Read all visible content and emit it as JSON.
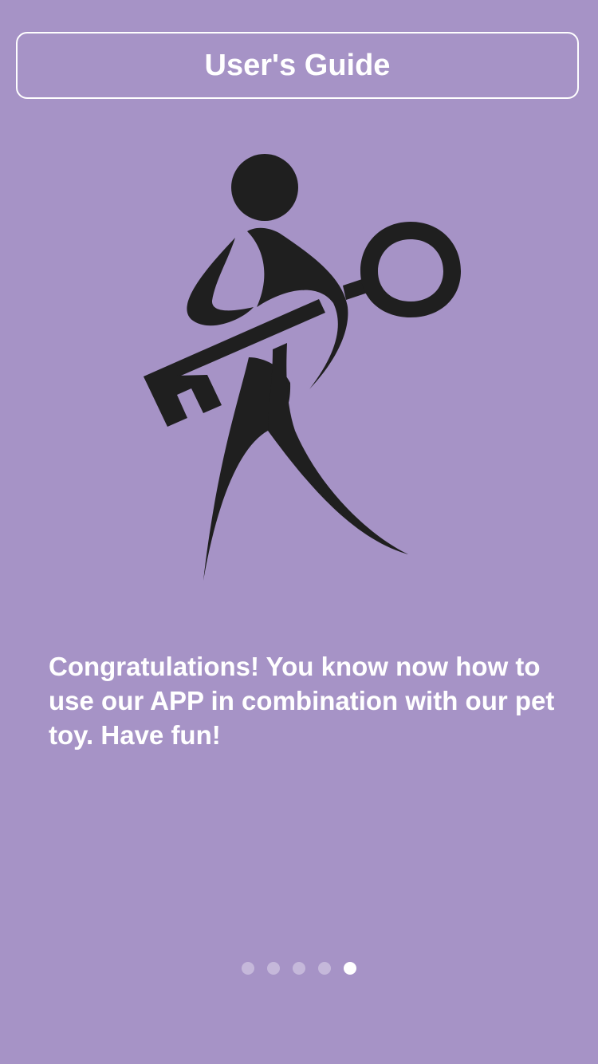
{
  "header": {
    "title": "User's Guide"
  },
  "illustration": {
    "icon": "person-with-key-icon",
    "color": "#1f1f1f"
  },
  "content": {
    "message": "Congratulations! You know now how to use our APP in combination with our pet toy. Have fun!"
  },
  "pager": {
    "total_pages": 5,
    "current_page": 5
  },
  "colors": {
    "background": "#a693c6",
    "text": "#ffffff",
    "dot_inactive": "rgba(255,255,255,0.35)",
    "dot_active": "#ffffff"
  }
}
